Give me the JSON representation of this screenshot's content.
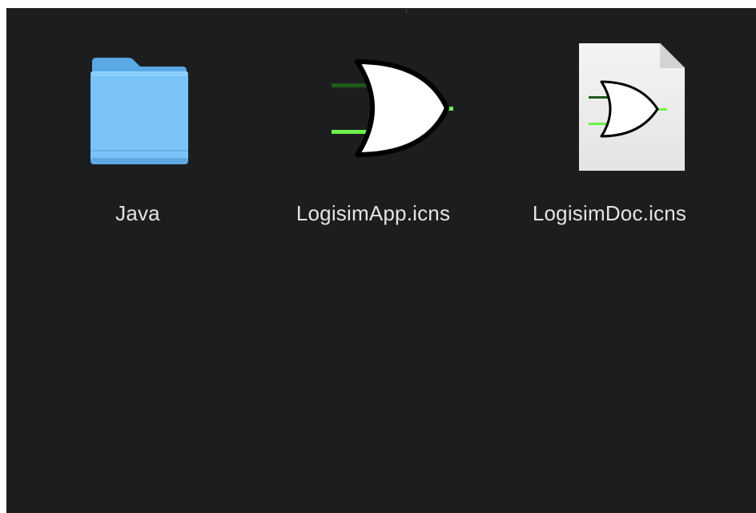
{
  "finder": {
    "items": [
      {
        "name": "Java",
        "kind": "folder",
        "icon": "folder-icon"
      },
      {
        "name": "LogisimApp.icns",
        "kind": "icns",
        "icon": "or-gate-icon"
      },
      {
        "name": "LogisimDoc.icns",
        "kind": "icns",
        "icon": "document-or-gate-icon"
      }
    ]
  },
  "colors": {
    "background": "#1c1d1f",
    "label": "#e4e4e6",
    "folder_blue": "#76c3fb",
    "wire_green": "#6ff04a",
    "wire_dark_green": "#1f5a1a"
  }
}
